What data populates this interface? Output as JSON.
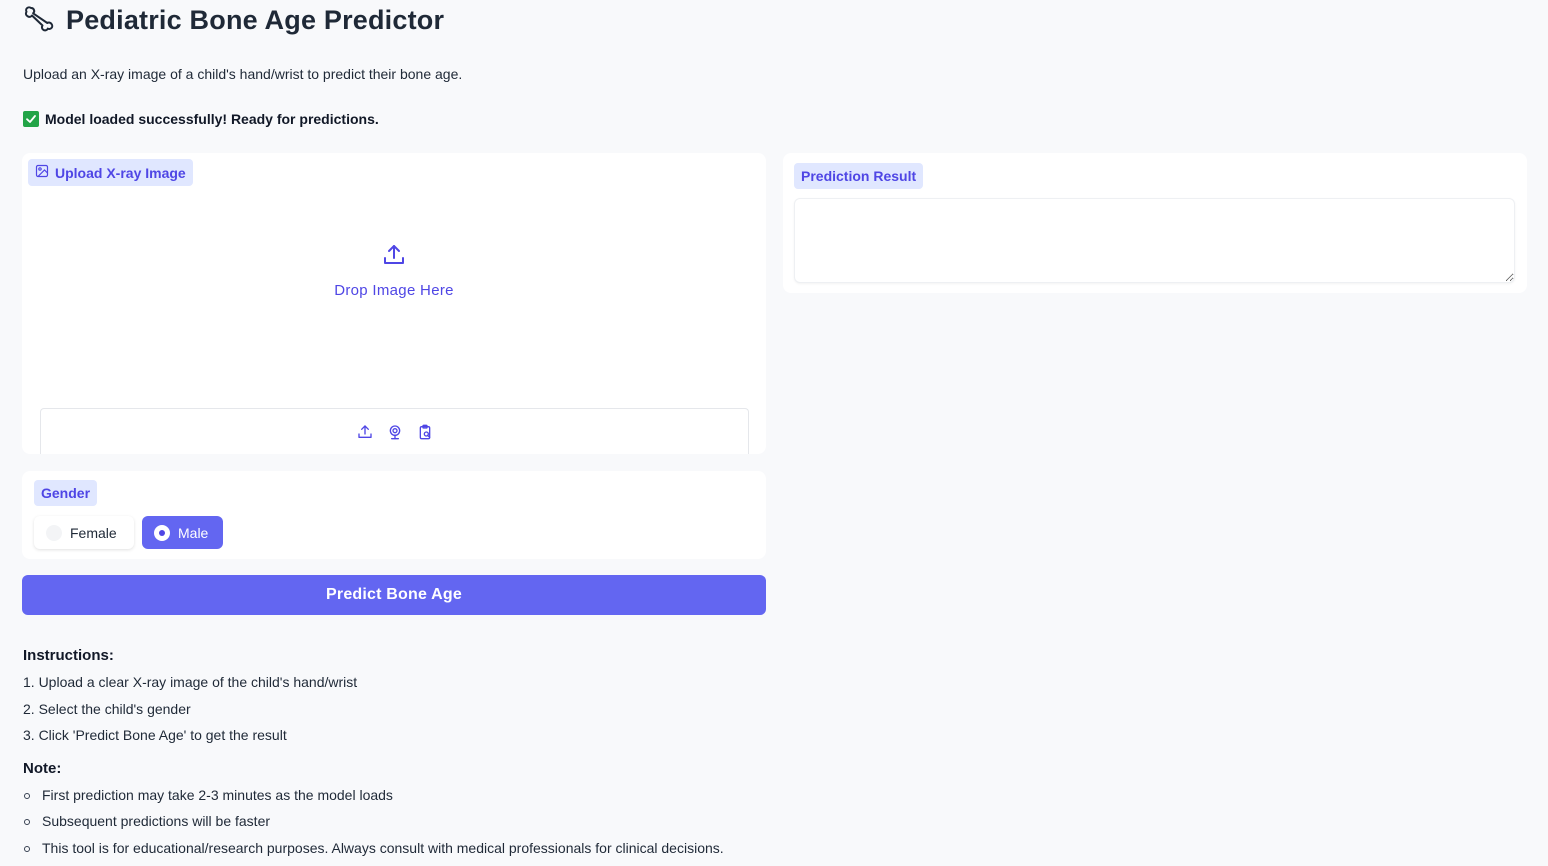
{
  "header": {
    "icon": "bone-icon",
    "title": "Pediatric Bone Age Predictor",
    "subtitle": "Upload an X-ray image of a child's hand/wrist to predict their bone age.",
    "status": "Model loaded successfully! Ready for predictions."
  },
  "upload": {
    "label": "Upload X-ray Image",
    "drop_text": "Drop Image Here",
    "sources": [
      "upload-icon",
      "webcam-icon",
      "clipboard-icon"
    ]
  },
  "result": {
    "label": "Prediction Result",
    "value": ""
  },
  "gender": {
    "label": "Gender",
    "options": [
      "Female",
      "Male"
    ],
    "selected": "Male"
  },
  "predict_button": "Predict Bone Age",
  "instructions": {
    "title": "Instructions:",
    "steps": [
      "1. Upload a clear X-ray image of the child's hand/wrist",
      "2. Select the child's gender",
      "3. Click 'Predict Bone Age' to get the result"
    ]
  },
  "note": {
    "title": "Note:",
    "items": [
      "First prediction may take 2-3 minutes as the model loads",
      "Subsequent predictions will be faster",
      "This tool is for educational/research purposes. Always consult with medical professionals for clinical decisions."
    ]
  },
  "colors": {
    "accent": "#6366f1",
    "accent_text": "#4f46e5",
    "chip_bg": "#e0e7ff",
    "success": "#22a447",
    "background": "#f8f9fb"
  }
}
